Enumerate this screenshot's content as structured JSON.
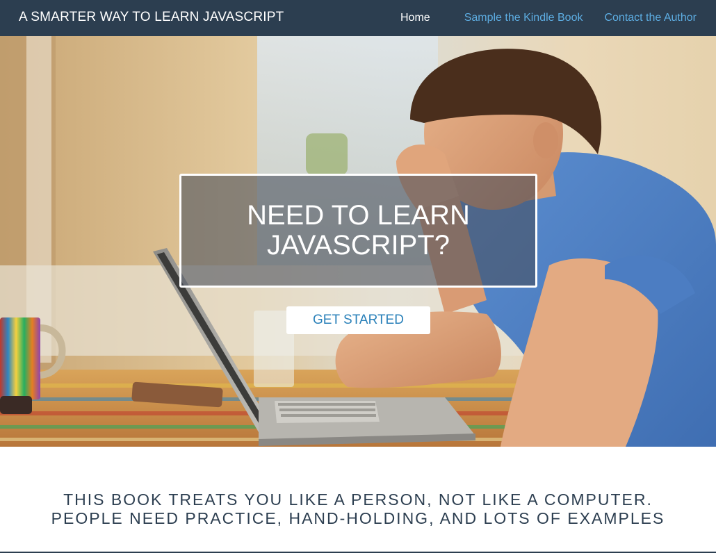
{
  "navbar": {
    "brand": "A SMARTER WAY TO LEARN JAVASCRIPT",
    "links": [
      {
        "label": "Home",
        "active": true
      },
      {
        "label": "Sample the Kindle Book",
        "active": false
      },
      {
        "label": "Contact the Author",
        "active": false
      }
    ]
  },
  "hero": {
    "headline": "NEED TO LEARN JAVASCRIPT?",
    "cta_label": "GET STARTED"
  },
  "tagline": {
    "line1": "THIS BOOK TREATS YOU LIKE A PERSON, NOT LIKE A COMPUTER.",
    "line2": "PEOPLE NEED PRACTICE, HAND-HOLDING, AND LOTS OF EXAMPLES"
  },
  "colors": {
    "navbar_bg": "#2c3e50",
    "nav_link": "#5dade2",
    "cta_text": "#2980b9",
    "tagline_text": "#2c3e50"
  },
  "icons": {
    "hero_image": "man-with-laptop-photo"
  }
}
